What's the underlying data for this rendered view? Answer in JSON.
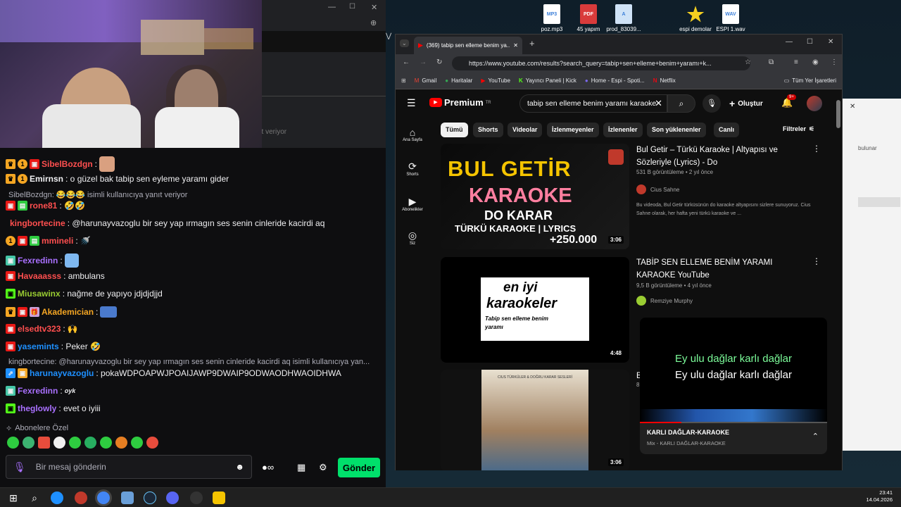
{
  "desktop_icons": [
    {
      "label": "poz.mp3",
      "tag": "MP3",
      "color": "#3b7fd9"
    },
    {
      "label": "45 yapım",
      "tag": "PDF",
      "color": "#d93b3b"
    },
    {
      "label": "prod_83039...",
      "tag": "A",
      "color": "#3b9fd9"
    },
    {
      "label": "espi demolar",
      "tag": "★",
      "color": "#f5d020"
    },
    {
      "label": "ESPI 1.wav",
      "tag": "WAV",
      "color": "#3b7fd9"
    }
  ],
  "dark_window": {
    "partial_text": "nt veriyor"
  },
  "chat": {
    "lines": [
      {
        "user": "SibelBozdgn",
        "color": "#ff4f4f",
        "msg": ":",
        "badges": [
          "crown",
          "1",
          "sub"
        ]
      },
      {
        "user": "Emirnsn",
        "color": "#efeff1",
        "msg": ": o güzel bak tabip sen eyleme yaramı gider",
        "badges": [
          "crown",
          "1"
        ]
      },
      {
        "user": "rone81",
        "color": "#ff4f4f",
        "msg": ": 🤣🤣",
        "badges": [
          "sub",
          "gift"
        ]
      },
      {
        "user": "kingbortecine",
        "color": "#ff4f4f",
        "msg": ": @harunayvazoglu bir sey yap ırmagın ses senin cinleride kacirdi aq",
        "badges": []
      },
      {
        "user": "mmineli",
        "color": "#ff4f4f",
        "msg": ":",
        "badges": [
          "1",
          "sub",
          "gift"
        ]
      },
      {
        "user": "Fexredinn",
        "color": "#a970ff",
        "msg": ":",
        "badges": [
          "mod"
        ]
      },
      {
        "user": "Havaaasss",
        "color": "#ff4f4f",
        "msg": ": ambulans",
        "badges": [
          "sub"
        ]
      },
      {
        "user": "Miusawinx",
        "color": "#9acd32",
        "msg": ": nağme de yapıyo jdjdjdjjd",
        "badges": [
          "mod"
        ]
      },
      {
        "user": "Akademician",
        "color": "#f5a623",
        "msg": ":",
        "badges": [
          "crown",
          "sub",
          "gift"
        ]
      },
      {
        "user": "elsedtv323",
        "color": "#ff4f4f",
        "msg": ":",
        "badges": [
          "sub"
        ]
      },
      {
        "user": "yasemints",
        "color": "#1e90ff",
        "msg": ": Peker 🤣",
        "badges": [
          "sub"
        ]
      },
      {
        "user": "harunayvazoglu",
        "color": "#1e90ff",
        "msg": ": pokaWDPOAPWJPOAIJAWP9DWAIP9ODWAODHWAOIDHWA",
        "badges": [
          "arrow",
          "orange"
        ]
      },
      {
        "user": "Fexredinn",
        "color": "#a970ff",
        "msg": ":",
        "badges": [
          "mod"
        ]
      },
      {
        "user": "theglowly",
        "color": "#a970ff",
        "msg": ": evet o iyiii",
        "badges": [
          "mod"
        ]
      }
    ],
    "replies": [
      "SibelBozdgn: 😂😂😂 isimli kullanıcıya yanıt veriyor",
      "kingbortecine: @harunayvazoglu bir sey yap ırmagın ses senin cinleride kacirdi aq isimli kullanıcıya yan..."
    ],
    "sub_only_label": "Abonelere Özel",
    "input_placeholder": "Bir mesaj gönderin",
    "send_label": "Gönder"
  },
  "chrome": {
    "tab_title": "(369) tabip sen elleme benim ya...",
    "url": "https://www.youtube.com/results?search_query=tabip+sen+elleme+benim+yaramı+k...",
    "bookmarks": [
      "Gmail",
      "Haritalar",
      "YouTube",
      "Yayıncı Paneli | Kick",
      "Home - Espi - Spoti...",
      "Netflix"
    ],
    "all_bookmarks": "Tüm Yer İşaretleri"
  },
  "youtube": {
    "brand": "Premium",
    "brand_sup": "TR",
    "search_value": "tabip sen elleme benim yaramı karaoke",
    "create_label": "Oluştur",
    "notif_count": "9+",
    "side_items": [
      "Ana Sayfa",
      "Shorts",
      "Abonelikler",
      "Siz"
    ],
    "chips": [
      "Tümü",
      "Shorts",
      "Videolar",
      "İzlenmeyenler",
      "İzlenenler",
      "Son yüklenenler",
      "Canlı"
    ],
    "filters_label": "Filtreler",
    "videos": [
      {
        "title": "Bul Getir – Türkü Karaoke | Altyapısı ve Sözleriyle (Lyrics) - Do",
        "meta": "531 B görüntüleme • 2 yıl önce",
        "channel": "Cius Sahne",
        "desc": "Bu videoda, Bul Getir türküsünün do karaoke altyapısını sizlere sunuyoruz. Cius Sahne olarak, her hafta yeni türkü karaoke ve ...",
        "duration": "3:06",
        "thumb_l1": "BUL GETİR",
        "thumb_l2": "KARAOKE",
        "thumb_l3": "DO KARAR",
        "thumb_l4": "TÜRKÜ KARAOKE | LYRICS",
        "thumb_l5": "+250.000"
      },
      {
        "title": "TABİP SEN ELLEME BENİM YARAMI KARAOKE YouTube",
        "meta": "9,5 B görüntüleme • 4 yıl önce",
        "channel": "Remziye Murphy",
        "duration": "4:48",
        "thumb_l1": "en iyi",
        "thumb_l2": "karaokeler",
        "thumb_l3": "Tabip sen elleme benim",
        "thumb_l4": "yaramı"
      },
      {
        "title": "B",
        "meta": "8",
        "duration": "3:06",
        "thumb_l1": "CIUS TÜRKÜLER & DOĞRU KARAR SESLERİ"
      }
    ],
    "mini": {
      "lyric1": "Ey ulu dağlar karlı dağlar",
      "lyric2": "Ey ulu dağlar karlı dağlar",
      "title": "KARLI DAĞLAR-KARAOKE",
      "subtitle": "Mix - KARLI DAĞLAR-KARAOKE"
    }
  },
  "right_window": {
    "partial": "bulunar"
  },
  "clock": {
    "time": "23:41",
    "date": "14.04.2026"
  }
}
